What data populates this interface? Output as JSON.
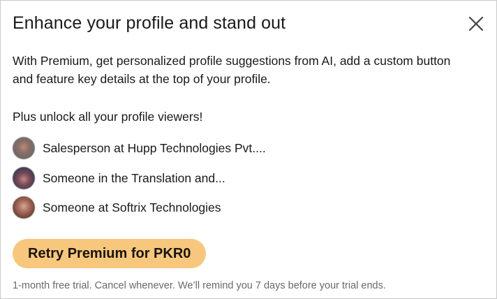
{
  "modal": {
    "title": "Enhance your profile and stand out",
    "close_icon": "close-icon",
    "description": "With Premium, get personalized profile suggestions from AI, add a custom button and feature key details at the top of your profile.",
    "unlock_text": "Plus unlock all your profile viewers!",
    "viewers": [
      {
        "label": "Salesperson at Hupp Technologies Pvt....",
        "icon": "blurred-avatar"
      },
      {
        "label": "Someone in the Translation and...",
        "icon": "blurred-avatar"
      },
      {
        "label": "Someone at Softrix Technologies",
        "icon": "blurred-avatar"
      }
    ],
    "cta_label": "Retry Premium for PKR0",
    "fine_print": "1-month free trial. Cancel whenever. We’ll remind you 7 days before your trial ends."
  },
  "colors": {
    "cta_background": "#f8c77e",
    "primary_text": "#1a1a1a",
    "secondary_text": "#666666",
    "border": "#c9c9c9"
  }
}
